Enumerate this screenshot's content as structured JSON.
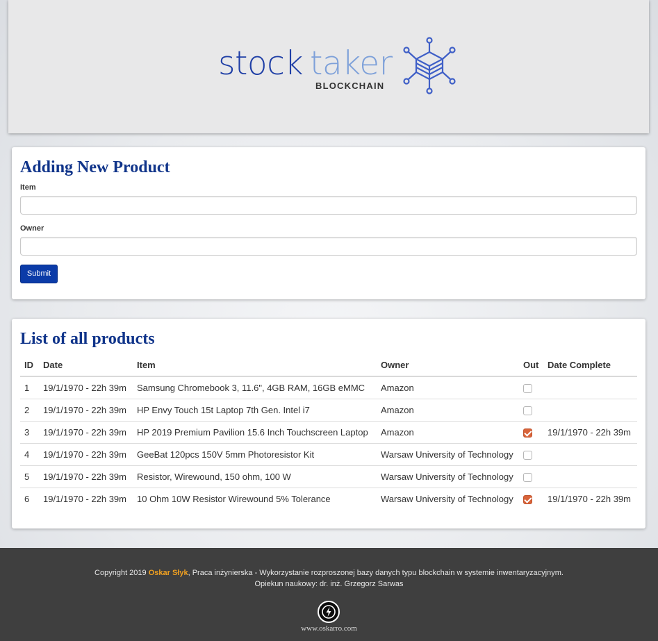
{
  "header": {
    "logo": {
      "word_part1": "stock",
      "word_part2": "taker",
      "subtitle": "BLOCKCHAIN",
      "colors": {
        "primary": "#1f3fa6",
        "secondary": "#7da0d9",
        "mark": "#3f5fc7"
      }
    }
  },
  "form": {
    "title": "Adding New Product",
    "item_label": "Item",
    "item_value": "",
    "owner_label": "Owner",
    "owner_value": "",
    "submit_label": "Submit"
  },
  "list": {
    "title": "List of all products",
    "columns": [
      "ID",
      "Date",
      "Item",
      "Owner",
      "Out",
      "Date Complete"
    ],
    "rows": [
      {
        "id": "1",
        "date": "19/1/1970 - 22h 39m",
        "item": "Samsung Chromebook 3, 11.6\", 4GB RAM, 16GB eMMC",
        "owner": "Amazon",
        "out": false,
        "date_complete": ""
      },
      {
        "id": "2",
        "date": "19/1/1970 - 22h 39m",
        "item": "HP Envy Touch 15t Laptop 7th Gen. Intel i7",
        "owner": "Amazon",
        "out": false,
        "date_complete": ""
      },
      {
        "id": "3",
        "date": "19/1/1970 - 22h 39m",
        "item": "HP 2019 Premium Pavilion 15.6 Inch Touchscreen Laptop",
        "owner": "Amazon",
        "out": true,
        "date_complete": "19/1/1970 - 22h 39m"
      },
      {
        "id": "4",
        "date": "19/1/1970 - 22h 39m",
        "item": "GeeBat 120pcs 150V 5mm Photoresistor Kit",
        "owner": "Warsaw University of Technology",
        "out": false,
        "date_complete": ""
      },
      {
        "id": "5",
        "date": "19/1/1970 - 22h 39m",
        "item": "Resistor, Wirewound, 150 ohm, 100 W",
        "owner": "Warsaw University of Technology",
        "out": false,
        "date_complete": ""
      },
      {
        "id": "6",
        "date": "19/1/1970 - 22h 39m",
        "item": "10 Ohm 10W Resistor Wirewound 5% Tolerance",
        "owner": "Warsaw University of Technology",
        "out": true,
        "date_complete": "19/1/1970 - 22h 39m"
      }
    ]
  },
  "footer": {
    "copyright_prefix": "Copyright 2019 ",
    "author": "Oskar Słyk",
    "copyright_suffix": ", Praca inżynierska - Wykorzystanie rozproszonej bazy danych typu blockchain w systemie inwentaryzacyjnym.",
    "supervisor": "Opiekun naukowy: dr. inż. Grzegorz Sarwas",
    "logo_icon": "lightning-bolt-icon",
    "site": "www.oskarro.com"
  },
  "colors": {
    "accent": "#0b3ba8",
    "heading": "#10348a",
    "checkbox_checked": "#d9643a",
    "author_highlight": "#f0a020",
    "footer_bg": "#3f3f3f"
  }
}
